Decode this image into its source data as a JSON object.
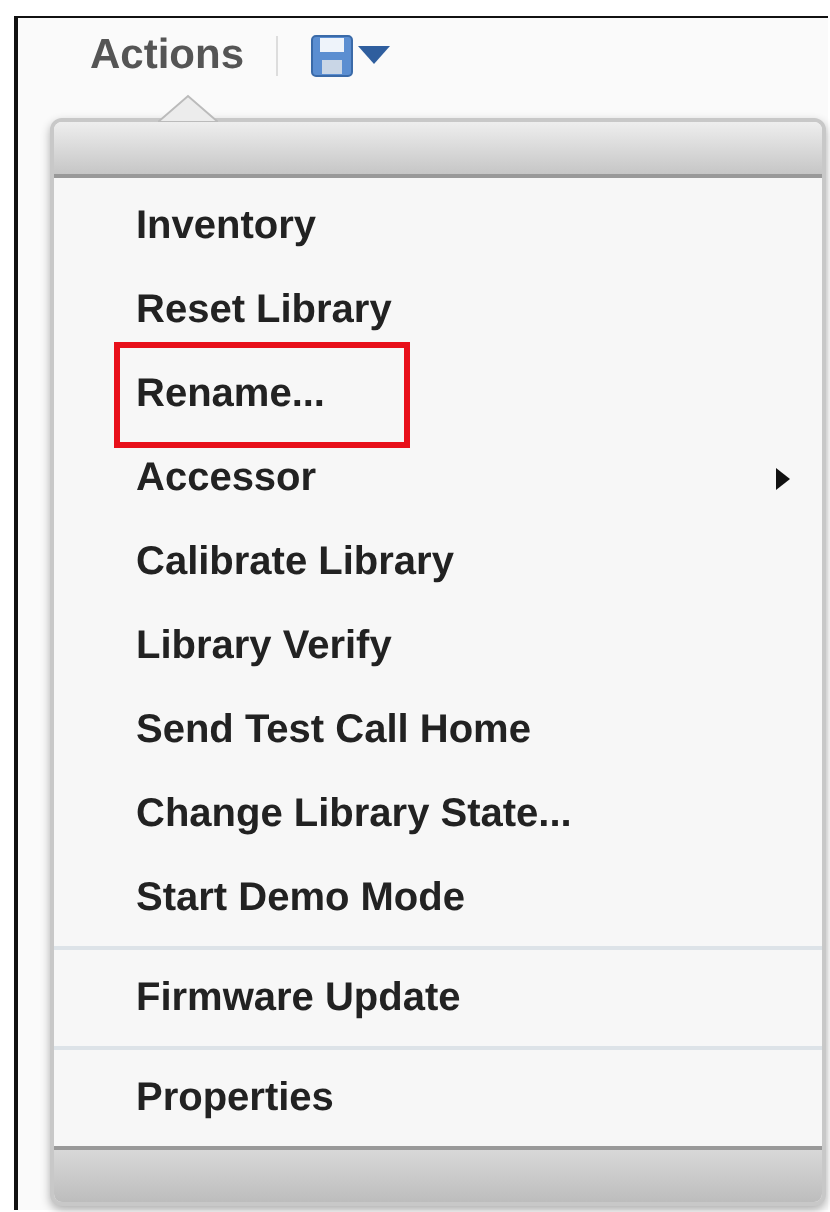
{
  "toolbar": {
    "menu_label": "Actions"
  },
  "menu": {
    "sections": [
      {
        "items": [
          {
            "label": "Inventory",
            "highlighted": false,
            "has_submenu": false
          },
          {
            "label": "Reset Library",
            "highlighted": false,
            "has_submenu": false
          },
          {
            "label": "Rename...",
            "highlighted": true,
            "has_submenu": false
          },
          {
            "label": "Accessor",
            "highlighted": false,
            "has_submenu": true
          },
          {
            "label": "Calibrate Library",
            "highlighted": false,
            "has_submenu": false
          },
          {
            "label": "Library Verify",
            "highlighted": false,
            "has_submenu": false
          },
          {
            "label": "Send Test Call Home",
            "highlighted": false,
            "has_submenu": false
          },
          {
            "label": "Change Library State...",
            "highlighted": false,
            "has_submenu": false
          },
          {
            "label": "Start Demo Mode",
            "highlighted": false,
            "has_submenu": false
          }
        ]
      },
      {
        "items": [
          {
            "label": "Firmware Update",
            "highlighted": false,
            "has_submenu": false
          }
        ]
      },
      {
        "items": [
          {
            "label": "Properties",
            "highlighted": false,
            "has_submenu": false
          }
        ]
      }
    ]
  }
}
